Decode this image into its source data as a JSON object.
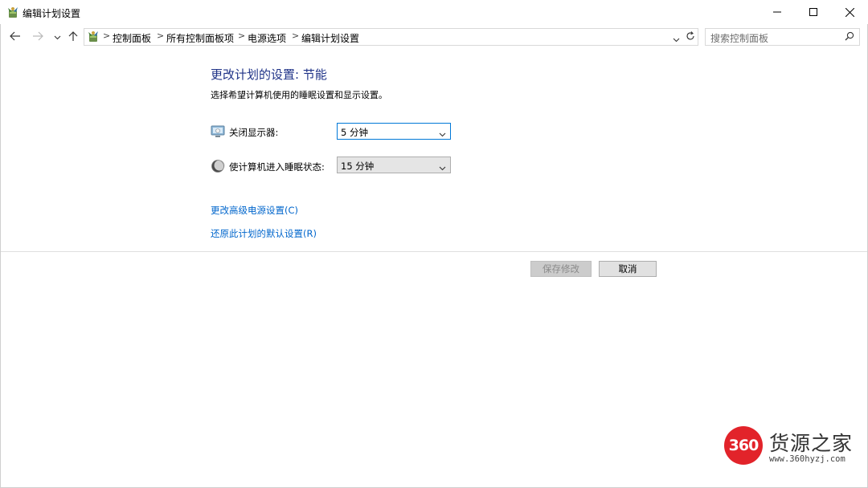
{
  "window": {
    "title": "编辑计划设置",
    "minimize_icon": "minimize-icon",
    "maximize_icon": "maximize-icon",
    "close_icon": "close-icon"
  },
  "address_bar": {
    "breadcrumbs": [
      "控制面板",
      "所有控制面板项",
      "电源选项",
      "编辑计划设置"
    ],
    "separator": ">"
  },
  "search": {
    "placeholder": "搜索控制面板"
  },
  "main": {
    "heading": "更改计划的设置: 节能",
    "description": "选择希望计算机使用的睡眠设置和显示设置。",
    "settings": [
      {
        "label": "关闭显示器:",
        "value": "5 分钟",
        "icon": "monitor-icon"
      },
      {
        "label": "使计算机进入睡眠状态:",
        "value": "15 分钟",
        "icon": "sleep-moon-icon"
      }
    ],
    "links": {
      "advanced": "更改高级电源设置(C)",
      "restore": "还原此计划的默认设置(R)"
    }
  },
  "buttons": {
    "save": "保存修改",
    "cancel": "取消"
  },
  "watermark": {
    "badge": "360",
    "name": "货源之家",
    "url": "www.360hyzj.com"
  },
  "colors": {
    "heading": "#1e3287",
    "link": "#0066cc",
    "focus": "#0078d7",
    "watermark_red": "#e2232a"
  }
}
